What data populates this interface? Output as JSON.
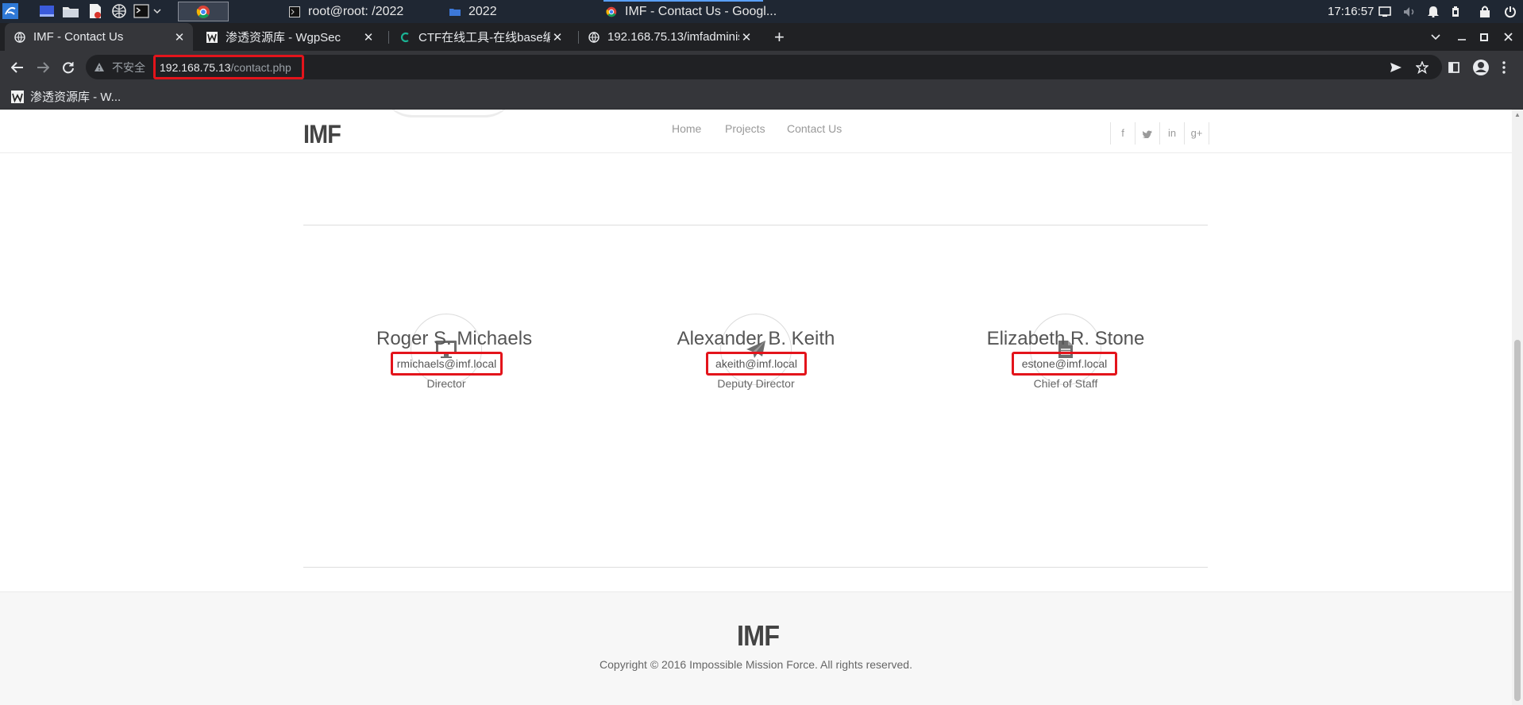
{
  "os_taskbar": {
    "windows": [
      {
        "label": "root@root: /2022"
      },
      {
        "label": "2022"
      },
      {
        "label": "IMF - Contact Us - Googl..."
      }
    ],
    "clock": "17:16:57"
  },
  "browser": {
    "tabs": [
      {
        "title": "IMF - Contact Us",
        "active": true
      },
      {
        "title": "渗透资源库 - WgpSec",
        "active": false
      },
      {
        "title": "CTF在线工具-在线base编",
        "active": false
      },
      {
        "title": "192.168.75.13/imfadminis",
        "active": false
      }
    ],
    "new_tab": "+",
    "security_label": "不安全",
    "url_host": "192.168.75.13",
    "url_path": "/contact.php",
    "bookmarks": [
      {
        "label": "渗透资源库 - W..."
      }
    ]
  },
  "site": {
    "logo": "IMF",
    "nav": [
      {
        "label": "Home"
      },
      {
        "label": "Projects"
      },
      {
        "label": "Contact Us"
      }
    ],
    "social": [
      "f",
      "t",
      "in",
      "g+"
    ],
    "contacts": [
      {
        "name": "Roger S. Michaels",
        "email": "rmichaels@imf.local",
        "role": "Director",
        "icon": "desktop-icon"
      },
      {
        "name": "Alexander B. Keith",
        "email": "akeith@imf.local",
        "role": "Deputy Director",
        "icon": "paper-plane-icon"
      },
      {
        "name": "Elizabeth R. Stone",
        "email": "estone@imf.local",
        "role": "Chief of Staff",
        "icon": "document-icon"
      }
    ],
    "footer_logo": "IMF",
    "copyright": "Copyright © 2016 Impossible Mission Force. All rights reserved."
  },
  "colors": {
    "highlight_box": "#e3141b",
    "browser_frame": "#202124",
    "toolbar": "#35363a"
  }
}
